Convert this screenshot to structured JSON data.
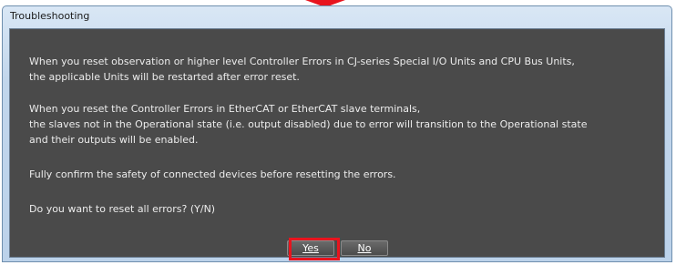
{
  "window": {
    "title": "Troubleshooting"
  },
  "message": {
    "p1_line1": "When you reset observation or higher level Controller Errors in CJ-series Special I/O Units and CPU Bus Units,",
    "p1_line2": "the applicable Units will be restarted after error reset.",
    "p2_line1": "When you reset the Controller Errors in EtherCAT or EtherCAT slave terminals,",
    "p2_line2": "the slaves not in the Operational state (i.e. output disabled) due to error will transition to the Operational state",
    "p2_line3": "and their outputs will be enabled.",
    "p3": "Fully confirm the safety of connected devices before resetting the errors.",
    "question": "Do you want to reset all errors? (Y/N)"
  },
  "buttons": {
    "yes_label": "Yes",
    "no_label": "No"
  },
  "colors": {
    "highlight": "#e8141e",
    "client_bg": "#4a4a4a",
    "titlebar_bg": "#c1d6ec"
  }
}
